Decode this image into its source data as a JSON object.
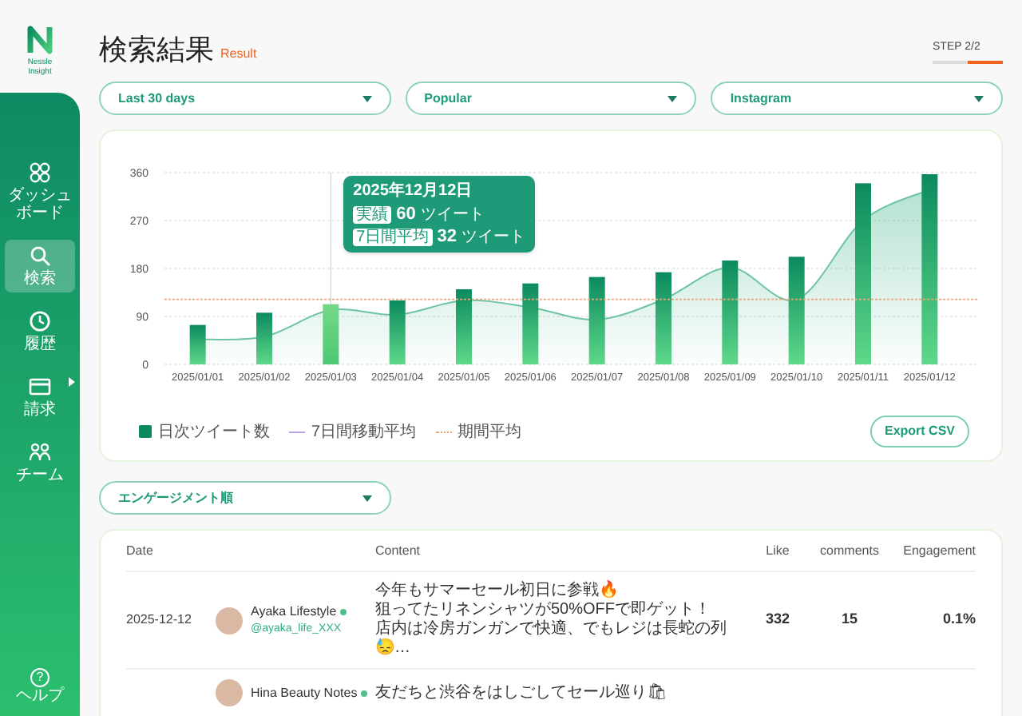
{
  "sidebar": {
    "logo_text": "Nessle Insight",
    "items": [
      {
        "label": "ダッシュボード",
        "selected": false,
        "has_submenu": false
      },
      {
        "label": "検索",
        "selected": true,
        "has_submenu": false
      },
      {
        "label": "履歴",
        "selected": false,
        "has_submenu": false
      },
      {
        "label": "請求",
        "selected": false,
        "has_submenu": true
      },
      {
        "label": "チーム",
        "selected": false,
        "has_submenu": false
      }
    ],
    "help": {
      "icon_text": "?",
      "label": "ヘルプ"
    }
  },
  "header": {
    "title": "検索結果",
    "subtitle": "Result",
    "step": "STEP 2/2",
    "steps": [
      {
        "current": false
      },
      {
        "current": true
      }
    ]
  },
  "filters": [
    {
      "value": "Last 30 days"
    },
    {
      "value": "Popular"
    },
    {
      "value": "Instagram"
    }
  ],
  "chart": {
    "chart_data": {
      "type": "bar",
      "categories": [
        "2025/01/01",
        "2025/01/02",
        "2025/01/03",
        "2025/01/04",
        "2025/01/05",
        "2025/01/06",
        "2025/01/07",
        "2025/01/08",
        "2025/01/09",
        "2025/01/10",
        "2025/01/11",
        "2025/01/12"
      ],
      "series": [
        {
          "name": "日次ツイート数",
          "color": "#0b8a5e",
          "values": [
            74,
            97,
            113,
            120,
            141,
            152,
            164,
            173,
            195,
            202,
            340,
            357
          ]
        },
        {
          "name": "7日間移動平均",
          "type": "area",
          "color": "#6cc4a4",
          "values": [
            47,
            52,
            102,
            93,
            120,
            107,
            84,
            122,
            182,
            122,
            270,
            328
          ]
        }
      ],
      "ylim": [
        0,
        360
      ],
      "yticks": [
        0,
        90,
        180,
        270,
        360
      ],
      "grid": true,
      "ref_lines": [
        {
          "axis": "y",
          "value": 122,
          "label": "期間平均"
        },
        {
          "axis": "x",
          "value": "2025/01/03"
        }
      ]
    },
    "bars": [
      {
        "selected": false
      },
      {
        "selected": false
      },
      {
        "selected": true
      },
      {
        "selected": false
      },
      {
        "selected": false
      },
      {
        "selected": false
      },
      {
        "selected": false
      },
      {
        "selected": false
      },
      {
        "selected": false
      },
      {
        "selected": false
      },
      {
        "selected": false
      },
      {
        "selected": false
      }
    ],
    "tooltip": {
      "title": "2025年12月12日",
      "rows": [
        {
          "badge": "実績",
          "value": "60",
          "unit": "ツイート"
        },
        {
          "badge": "7日間平均",
          "value": "32",
          "unit": "ツイート"
        }
      ]
    },
    "legend": [
      {
        "kind": "box",
        "color": "#0b8a5e"
      },
      {
        "kind": "line",
        "color": "#b9a3e6"
      },
      {
        "kind": "dotted",
        "color": "#f0a27a"
      }
    ],
    "export_button": "Export CSV"
  },
  "sort": {
    "value": "エンゲージメント順"
  },
  "table": {
    "columns": [
      "Date",
      "Content",
      "Like",
      "comments",
      "Engagement"
    ],
    "rows": [
      {
        "date": "2025-12-12",
        "account": {
          "name": "Ayaka Lifestyle",
          "handle": "@ayaka_life_XXX",
          "verified": true
        },
        "content": [
          "今年もサマーセール初日に参戦🔥",
          "狙ってたリネンシャツが50%OFFで即ゲット！",
          "店内は冷房ガンガンで快適、でもレジは長蛇の列😓…"
        ],
        "like": "332",
        "comments": "15",
        "engagement": "0.1%"
      },
      {
        "account": {
          "name": "Hina Beauty Notes",
          "verified": true
        },
        "content": [
          "友だちと渋谷をはしごしてセール巡り🛍"
        ]
      }
    ]
  }
}
